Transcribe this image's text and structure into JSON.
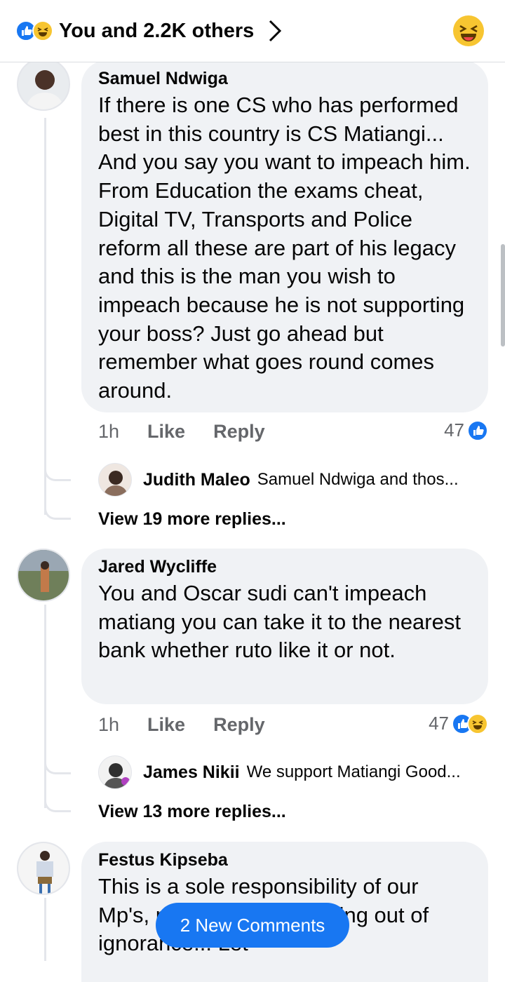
{
  "header": {
    "summary_text": "You and 2.2K others",
    "reaction_icons": [
      "like-icon",
      "haha-icon"
    ],
    "right_icon": "haha-icon"
  },
  "comments": [
    {
      "author": "Samuel Ndwiga",
      "text": "If there is one CS who has performed best in this country is CS Matiangi... And you say you want to impeach him. From Education the exams cheat, Digital TV, Transports and Police reform all these are part of his legacy and this is the man you wish to impeach because he is not supporting your boss? Just go ahead but remember what goes round comes around.",
      "time": "1h",
      "like_label": "Like",
      "reply_label": "Reply",
      "reaction_count": "47",
      "reaction_icons": [
        "like-icon"
      ],
      "reply_preview": {
        "author": "Judith Maleo",
        "text": "Samuel Ndwiga and thos..."
      },
      "more_replies": "View 19 more replies..."
    },
    {
      "author": "Jared Wycliffe",
      "text": "You and Oscar sudi can't impeach matiang you can take it to the nearest bank whether ruto like it or not.",
      "time": "1h",
      "like_label": "Like",
      "reply_label": "Reply",
      "reaction_count": "47",
      "reaction_icons": [
        "like-icon",
        "haha-icon"
      ],
      "reply_preview": {
        "author": "James Nikii",
        "text": "We support Matiangi Good..."
      },
      "more_replies": "View 13 more replies..."
    },
    {
      "author": "Festus Kipseba",
      "text": "This is a sole responsibility of our Mp's, ments are just coming out of ignorance... Let"
    }
  ],
  "new_comments_button": "2 New Comments",
  "colors": {
    "accent": "#1877f2",
    "bubble": "#f0f2f5",
    "haha": "#f7c531"
  }
}
